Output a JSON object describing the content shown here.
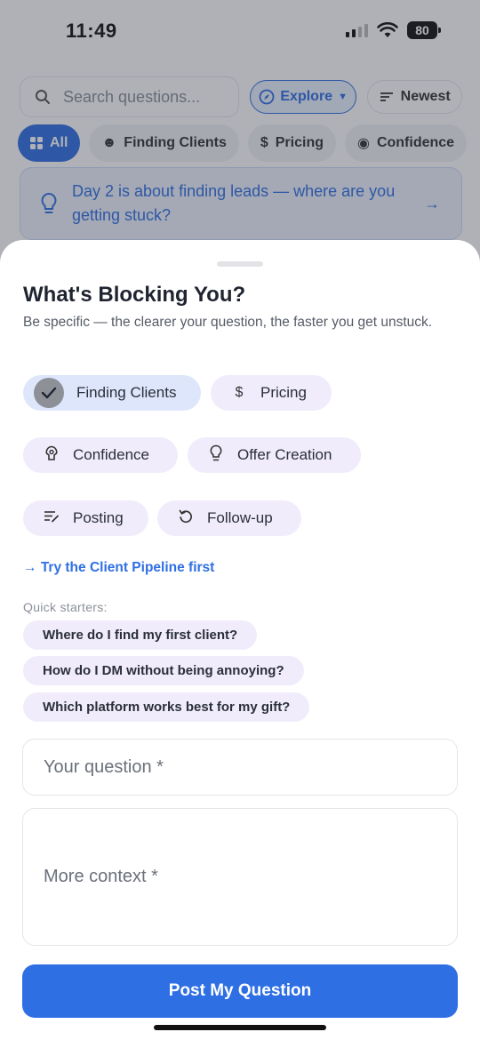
{
  "status": {
    "time": "11:49",
    "battery": "80"
  },
  "background": {
    "search_placeholder": "Search questions...",
    "explore_label": "Explore",
    "newest_label": "Newest",
    "filters": [
      "All",
      "Finding Clients",
      "Pricing",
      "Confidence"
    ],
    "tip_text": "Day 2 is about finding leads — where are you getting stuck?"
  },
  "sheet": {
    "title": "What's Blocking You?",
    "subtitle": "Be specific — the clearer your question, the faster you get unstuck.",
    "categories": [
      {
        "label": "Finding Clients",
        "icon": "check-icon",
        "selected": true
      },
      {
        "label": "Pricing",
        "icon": "dollar-icon",
        "selected": false
      },
      {
        "label": "Confidence",
        "icon": "brain-icon",
        "selected": false
      },
      {
        "label": "Offer Creation",
        "icon": "lightbulb-icon",
        "selected": false
      },
      {
        "label": "Posting",
        "icon": "edit-lines-icon",
        "selected": false
      },
      {
        "label": "Follow-up",
        "icon": "refresh-icon",
        "selected": false
      }
    ],
    "pipeline_link": "Try the Client Pipeline first",
    "quick_starters_label": "Quick starters:",
    "quick_starters": [
      "Where do I find my first client?",
      "How do I DM without being annoying?",
      "Which platform works best for my gift?"
    ],
    "question_placeholder": "Your question *",
    "context_placeholder": "More context *",
    "post_button": "Post My Question"
  },
  "colors": {
    "accent": "#2f6fe4",
    "chip_bg": "#f1ecfb",
    "selected_chip_bg": "#dde6fb"
  }
}
